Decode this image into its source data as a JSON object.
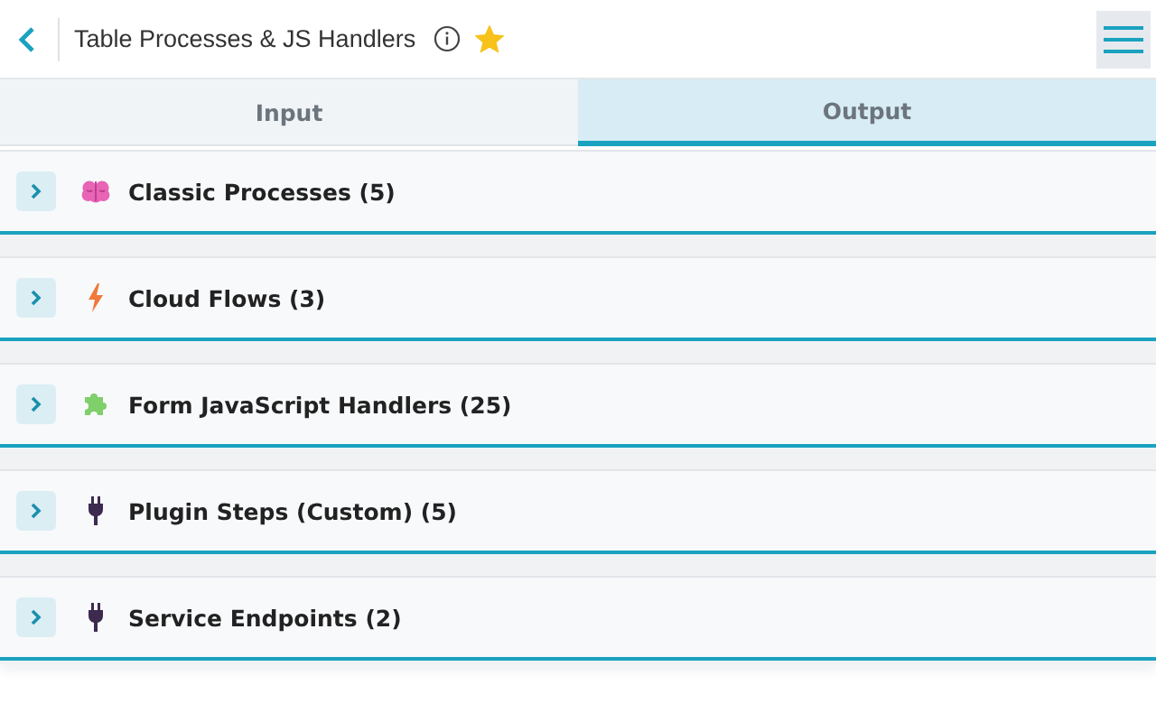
{
  "header": {
    "title": "Table Processes & JS Handlers",
    "favorite": true
  },
  "tabs": [
    {
      "label": "Input",
      "selected": false
    },
    {
      "label": "Output",
      "selected": true
    }
  ],
  "sections": [
    {
      "kind": "brain",
      "label": "Classic Processes (5)",
      "expanded": false
    },
    {
      "kind": "lightning",
      "label": "Cloud Flows (3)",
      "expanded": false
    },
    {
      "kind": "puzzle",
      "label": "Form JavaScript Handlers (25)",
      "expanded": false
    },
    {
      "kind": "plug",
      "label": "Plugin Steps (Custom) (5)",
      "expanded": false
    },
    {
      "kind": "plug",
      "label": "Service Endpoints (2)",
      "expanded": false
    }
  ]
}
